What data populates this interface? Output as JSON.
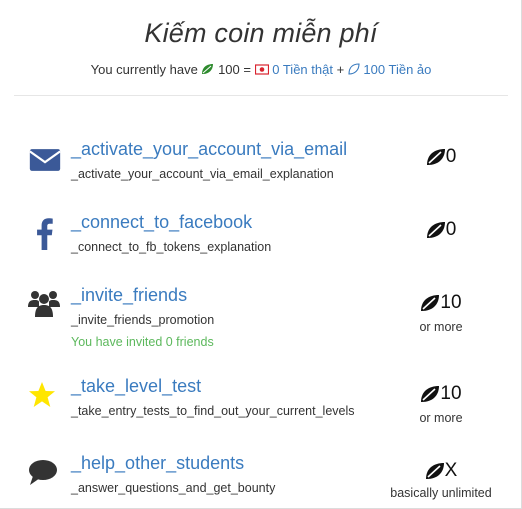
{
  "header": {
    "title": "Kiếm coin miễn phí",
    "balance_prefix": "You currently have",
    "balance_amount": "100 =",
    "real_money": "0 Tiền thật",
    "plus": "+",
    "virtual_money": "100 Tiền ảo"
  },
  "tasks": [
    {
      "icon": "envelope-icon",
      "title": "_activate_your_account_via_email",
      "description": "_activate_your_account_via_email_explanation",
      "reward": "0",
      "reward_note": ""
    },
    {
      "icon": "facebook-icon",
      "title": "_connect_to_facebook",
      "description": "_connect_to_fb_tokens_explanation",
      "reward": "0",
      "reward_note": ""
    },
    {
      "icon": "users-icon",
      "title": "_invite_friends",
      "description": "_invite_friends_promotion",
      "status": "You have invited 0 friends",
      "reward": "10",
      "reward_note": "or more"
    },
    {
      "icon": "star-icon",
      "title": "_take_level_test",
      "description": "_take_entry_tests_to_find_out_your_current_levels",
      "reward": "10",
      "reward_note": "or more"
    },
    {
      "icon": "comment-icon",
      "title": "_help_other_students",
      "description": "_answer_questions_and_get_bounty",
      "reward": "X",
      "reward_note": "basically unlimited"
    }
  ],
  "colors": {
    "link": "#3a7bbf",
    "success": "#5cb85c",
    "envelope": "#3b5998",
    "star": "#ffe600",
    "leaf_green": "#2e8b2e",
    "real_money_red": "#d9232e"
  }
}
